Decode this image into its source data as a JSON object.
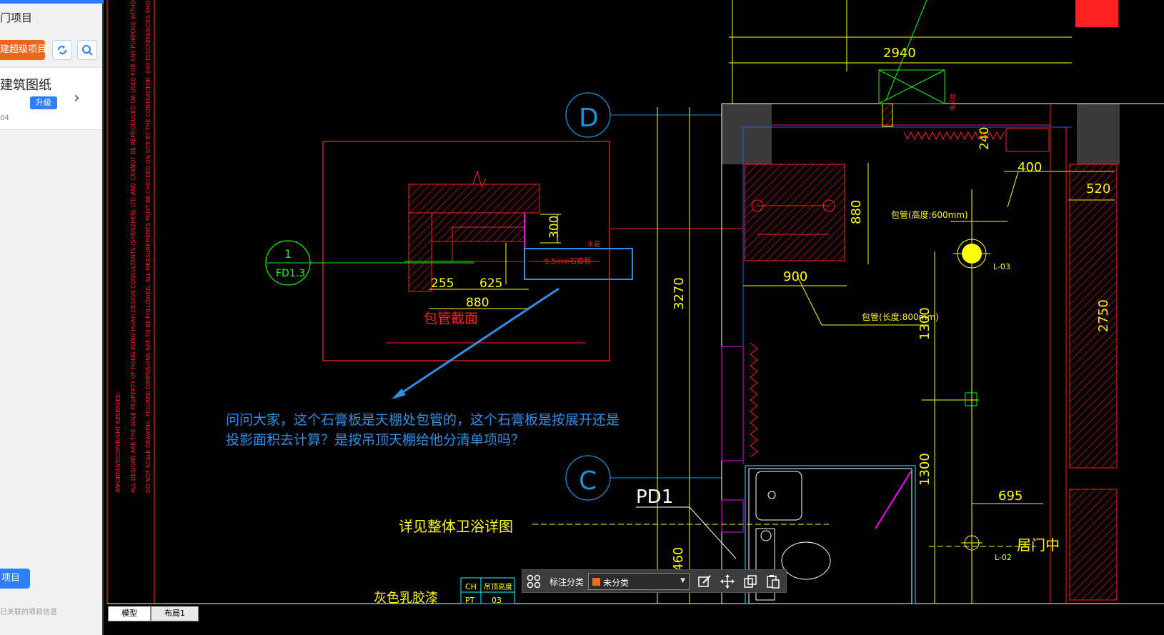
{
  "sidebar": {
    "title": "门项目",
    "new_button": "建超级项目",
    "card": {
      "title": "建筑图纸",
      "badge": "升级",
      "sub": "04"
    },
    "bottom_button": "项目",
    "footer": "已关联的项目信息"
  },
  "toolbar": {
    "label": "标注分类",
    "selected": "未分类",
    "swatch": "#ff6a1a"
  },
  "tabs": {
    "model": "模型",
    "layout": "布局1"
  },
  "question": {
    "line1": "问问大家，这个石膏板是天棚处包管的，这个石膏板是按展开还是",
    "line2": "投影面积去计算？是按吊顶天棚给他分清单项吗？"
  },
  "drawing": {
    "dim_2940": "2940",
    "dim_240": "240",
    "dim_400": "400",
    "dim_520": "520",
    "dim_880": "880",
    "dim_900": "900",
    "dim_3270": "3270",
    "dim_2750": "2750",
    "dim_1300a": "1300",
    "dim_1300b": "1300",
    "dim_695": "695",
    "dim_460": "460",
    "dim_300": "300",
    "dim_255": "255",
    "dim_625": "625",
    "dim_880b": "880",
    "grid_d": "D",
    "grid_c": "C",
    "callout_num": "1",
    "callout_ref": "FD1.3",
    "section_title": "包管截面",
    "gypsum_label": "9.5mm石膏板",
    "water_pipe": "水管",
    "pipe_width": "包管(高度:600mm)",
    "pipe_length": "包管(长度:800mm)",
    "lamp_1": "L-03",
    "lamp_2": "L-02",
    "pd1": "PD1",
    "bath_note": "详见整体卫浴详图",
    "center_note": "居门中",
    "paint_note": "灰色乳胶漆",
    "table_ch": "CH",
    "table_pt": "PT",
    "table_ceiling": "吊顶高度",
    "table_03": "03",
    "fan_note": "排风扇",
    "legal_1": "IMPORTANT:COPYRIGHT RESERVED.",
    "legal_2": "ALL DESIGNS ARE THE SOLE PROPERTY OF HONG KONG HUAYI DESIGN CONSULTANTS (SHENZHEN) LTD AND CANNOT BE REPRODUCED OR USED FOR ANY PURPOSE WITHOUT",
    "legal_3": "DO NOT SCALE DRAWING. FIGURED DIMENSIONS ARE TO BE FOLLOWED. ALL MEASUREMENTS MUST BE CHECKED ON SITE BY THE CONTRACTOR. ANY DISCREPANCIES SHOULD BE"
  }
}
